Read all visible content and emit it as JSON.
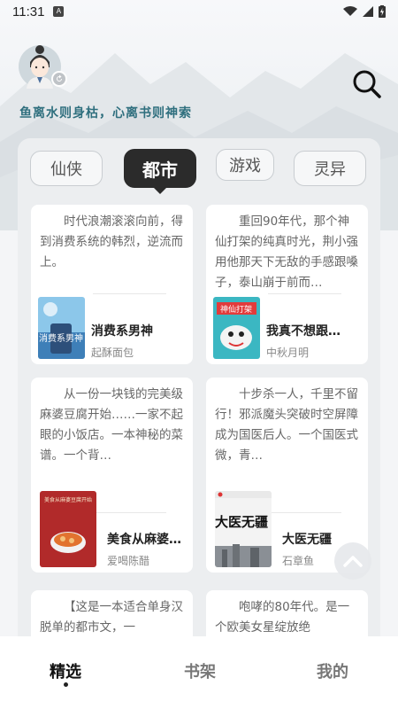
{
  "status_bar": {
    "time": "11:31",
    "app_badge": "A"
  },
  "header": {
    "slogan": "鱼离水则身枯，心离书则神索"
  },
  "tabs": [
    {
      "label": "仙侠",
      "active": false
    },
    {
      "label": "都市",
      "active": true
    },
    {
      "label": "游戏",
      "active": false
    },
    {
      "label": "灵异",
      "active": false
    }
  ],
  "books": [
    {
      "desc": "时代浪潮滚滚向前，得到消费系统的韩烈，逆流而上。",
      "title": "消费系男神",
      "author": "起酥面包",
      "cover_text": "消费系男神"
    },
    {
      "desc": "重回90年代，那个神仙打架的纯真时光，荆小强用他那天下无敌的手感跟嗓子，泰山崩于前而…",
      "title": "我真不想跟…",
      "author": "中秋月明",
      "cover_text": "神仙打架"
    },
    {
      "desc": "从一份一块钱的完美级麻婆豆腐开始……一家不起眼的小饭店。一本神秘的菜谱。一个背…",
      "title": "美食从麻婆…",
      "author": "爱喝陈醋",
      "cover_text": "美食从麻婆豆腐开始"
    },
    {
      "desc": "十步杀一人，千里不留行！邪派魔头突破时空屏障成为国医后人。一个国医式微，青…",
      "title": "大医无疆",
      "author": "石章鱼",
      "cover_text": "大医无疆"
    },
    {
      "desc": "【这是一本适合单身汉脱单的都市文，一",
      "title": "",
      "author": ""
    },
    {
      "desc": "咆哮的80年代。是一个欧美女星绽放绝",
      "title": "",
      "author": ""
    }
  ],
  "bottom_nav": [
    {
      "label": "精选",
      "active": true
    },
    {
      "label": "书架",
      "active": false
    },
    {
      "label": "我的",
      "active": false
    }
  ],
  "colors": {
    "accent": "#2b2b2b",
    "slogan": "#2f6f7e",
    "background": "#f4f5f7"
  }
}
